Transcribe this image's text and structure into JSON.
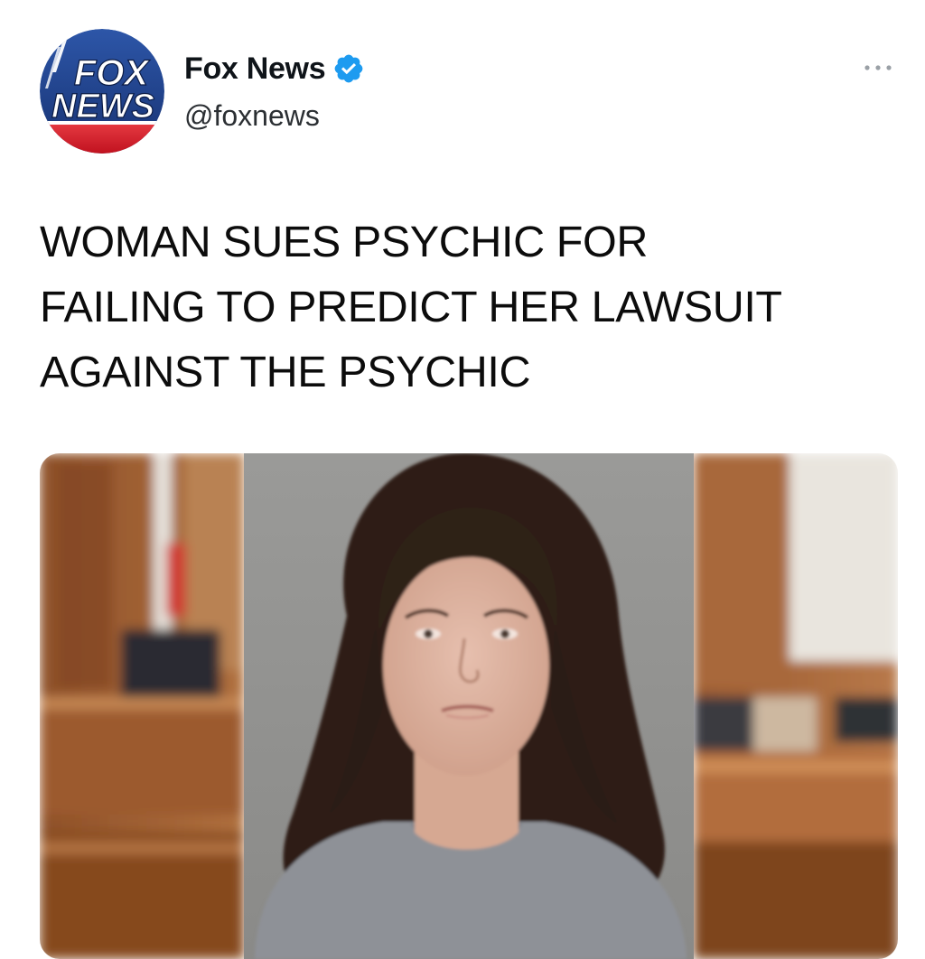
{
  "tweet": {
    "author": {
      "display_name": "Fox News",
      "handle": "@foxnews",
      "verified": true,
      "avatar_text_line1": "FOX",
      "avatar_text_line2": "NEWS"
    },
    "headline_lines": [
      "WOMAN SUES PSYCHIC FOR",
      "FAILING TO PREDICT HER LAWSUIT",
      "AGAINST THE PSYCHIC"
    ],
    "menu_icon": "more-horizontal-icon",
    "verified_icon": "verified-badge-icon"
  },
  "colors": {
    "brand_blue": "#1f3f88",
    "brand_red": "#d8202e",
    "verified_blue": "#1d9bf0",
    "text_primary": "#0f1419",
    "text_secondary": "#2b2f33",
    "wood": "#a05f33",
    "backdrop_grey": "#8f8f8f",
    "shirt_grey": "#8d9096",
    "hair_brown": "#2f2019"
  }
}
